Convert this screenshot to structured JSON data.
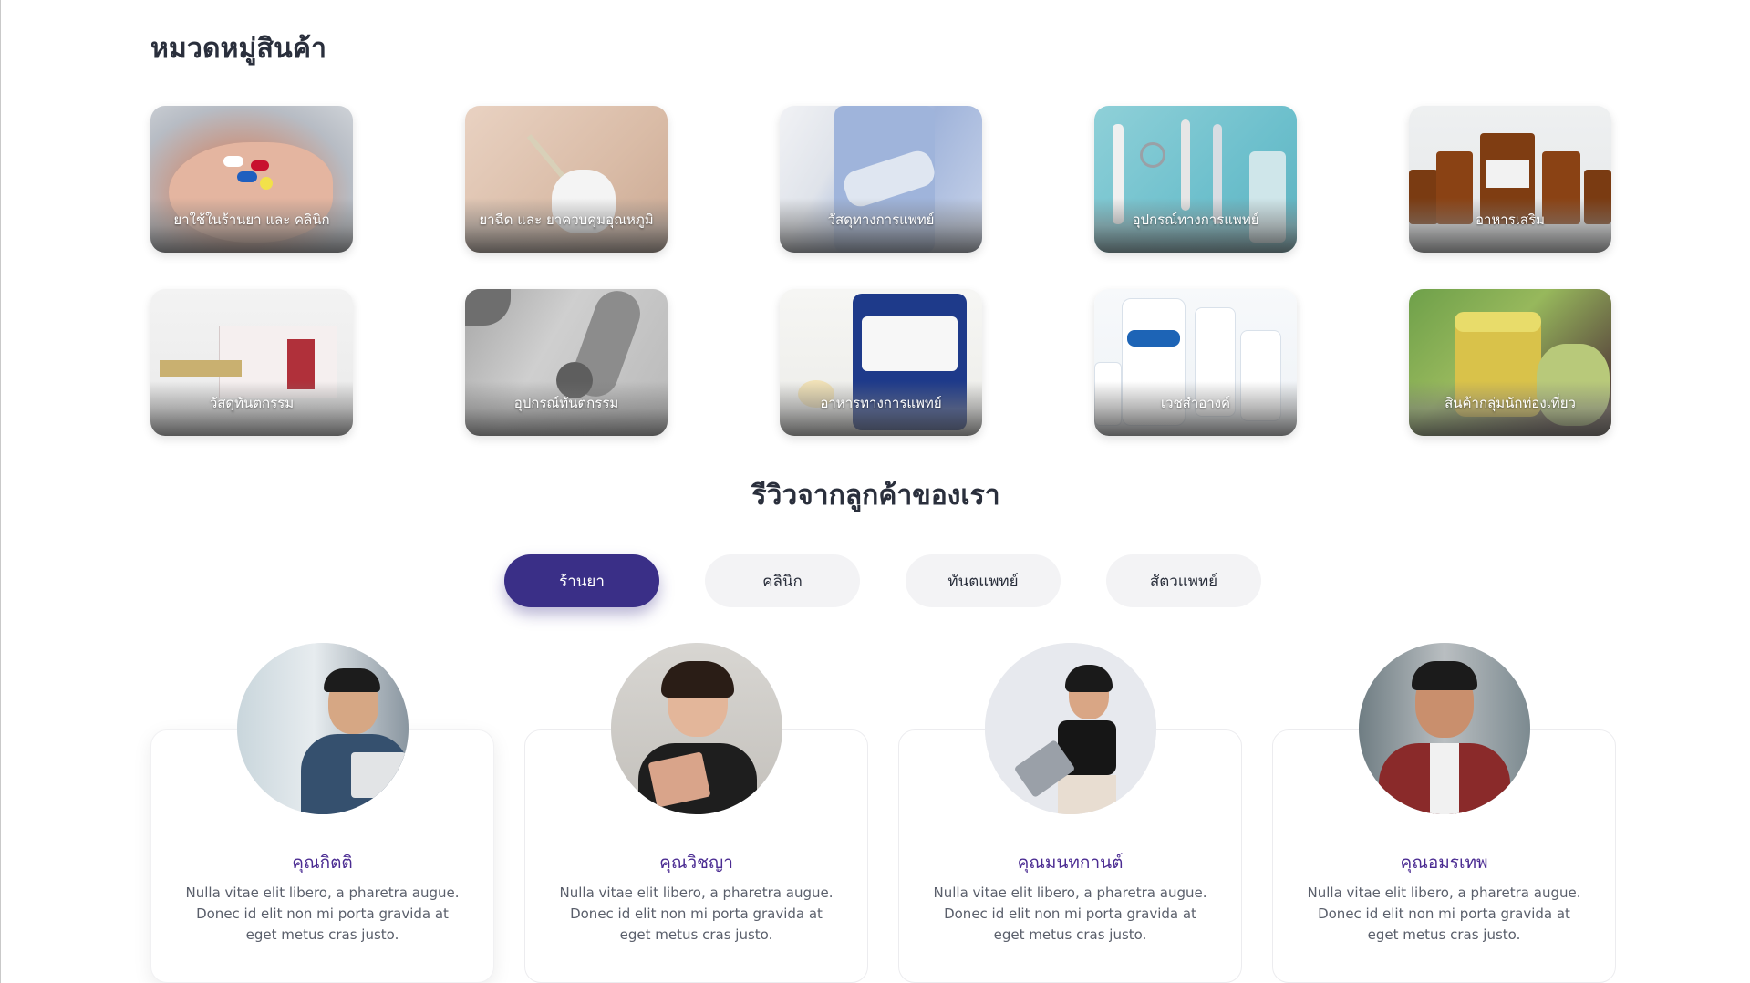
{
  "categories": {
    "heading": "หมวดหมู่สินค้า",
    "items": [
      {
        "label": "ยาใช้ในร้านยา และ คลินิก",
        "icon": "pills-image"
      },
      {
        "label": "ยาฉีด และ ยาควบคุมอุณหภูมิ",
        "icon": "syringe-image"
      },
      {
        "label": "วัสดุทางการแพทย์",
        "icon": "arm-sling-image"
      },
      {
        "label": "อุปกรณ์ทางการแพทย์",
        "icon": "medical-tools-image"
      },
      {
        "label": "อาหารเสริม",
        "icon": "supplement-bottles-image"
      },
      {
        "label": "วัสดุทันตกรรม",
        "icon": "dental-materials-image"
      },
      {
        "label": "อุปกรณ์ทันตกรรม",
        "icon": "dental-handpiece-image"
      },
      {
        "label": "อาหารทางการแพทย์",
        "icon": "ensure-can-image"
      },
      {
        "label": "เวชสำอางค์",
        "icon": "cetaphil-bottles-image"
      },
      {
        "label": "สินค้ากลุ่มนักท่องเที่ยว",
        "icon": "herbal-balm-image"
      }
    ]
  },
  "reviews": {
    "heading": "รีวิวจากลูกค้าของเรา",
    "tabs": [
      {
        "label": "ร้านยา",
        "active": true
      },
      {
        "label": "คลินิก",
        "active": false
      },
      {
        "label": "ทันตแพทย์",
        "active": false
      },
      {
        "label": "สัตวแพทย์",
        "active": false
      }
    ],
    "cards": [
      {
        "name": "คุณกิตติ",
        "text": "Nulla vitae elit libero, a pharetra augue. Donec id elit non mi porta gravida at eget metus cras justo."
      },
      {
        "name": "คุณวิชญา",
        "text": "Nulla vitae elit libero, a pharetra augue. Donec id elit non mi porta gravida at eget metus cras justo."
      },
      {
        "name": "คุณมนทกานต์",
        "text": "Nulla vitae elit libero, a pharetra augue. Donec id elit non mi porta gravida at eget metus cras justo."
      },
      {
        "name": "คุณอมรเทพ",
        "text": "Nulla vitae elit libero, a pharetra augue. Donec id elit non mi porta gravida at eget metus cras justo."
      }
    ]
  },
  "colors": {
    "primary": "#3a2f87",
    "name_text": "#4b2c92",
    "heading_text": "#2a2f3c",
    "tab_inactive": "#f3f3f5"
  }
}
